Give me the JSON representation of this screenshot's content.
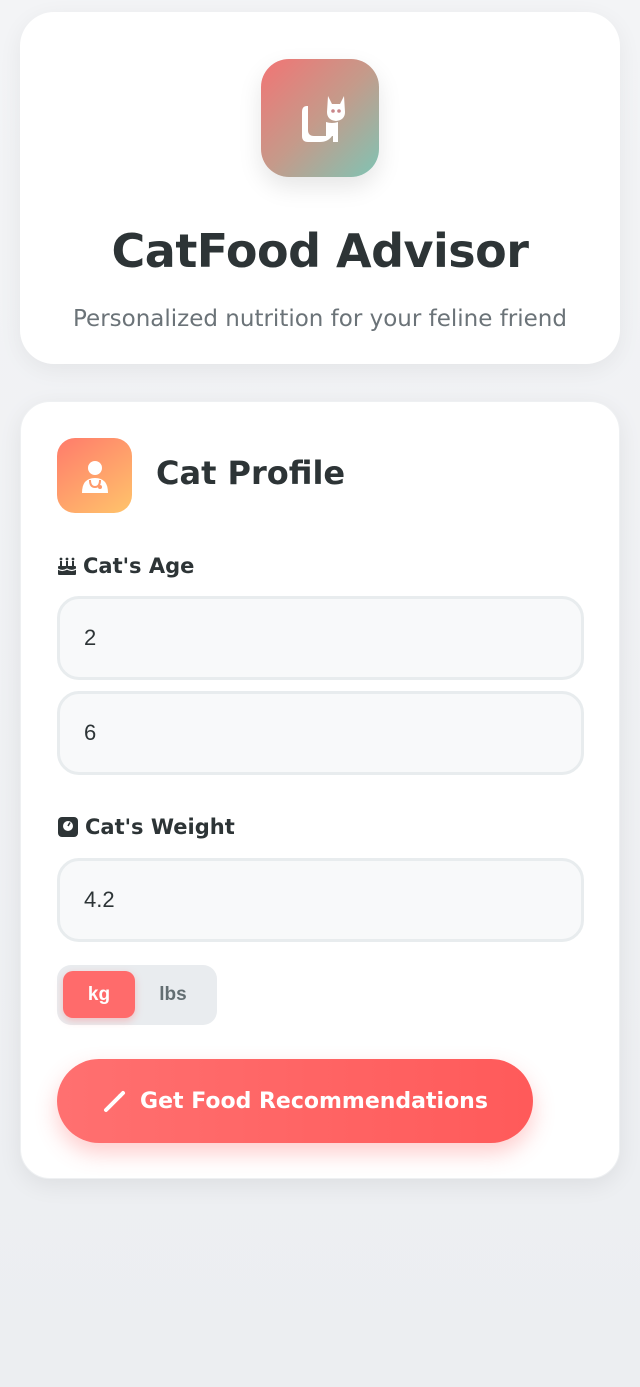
{
  "header": {
    "title": "CatFood Advisor",
    "subtitle": "Personalized nutrition for your feline friend",
    "logo_icon": "cat-icon",
    "logo_gradient": [
      "#f27474",
      "#7fc4b4"
    ]
  },
  "profile": {
    "title": "Cat Profile",
    "icon": "vet-icon",
    "age": {
      "label": "Cat's Age",
      "icon": "birthday-cake-icon",
      "years_value": "2",
      "months_value": "6"
    },
    "weight": {
      "label": "Cat's Weight",
      "icon": "scale-icon",
      "value": "4.2"
    },
    "units": {
      "options": [
        "kg",
        "lbs"
      ],
      "selected": "kg"
    },
    "submit": {
      "label": "Get Food Recommendations",
      "icon": "magic-wand-icon"
    }
  },
  "colors": {
    "accent": "#ff6b6b",
    "text": "#2d3436",
    "muted": "#636e72"
  }
}
